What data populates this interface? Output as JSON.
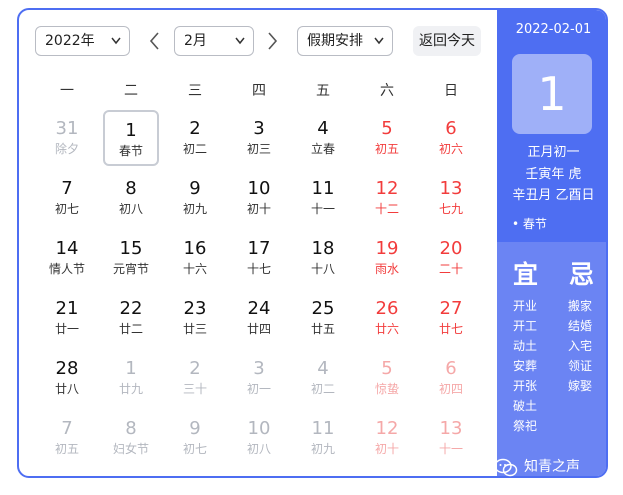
{
  "toolbar": {
    "year": "2022年",
    "month": "2月",
    "holiday": "假期安排",
    "today": "返回今天"
  },
  "weekdays": [
    "一",
    "二",
    "三",
    "四",
    "五",
    "六",
    "日"
  ],
  "days": [
    {
      "n": "31",
      "s": "除夕",
      "other": true
    },
    {
      "n": "1",
      "s": "春节",
      "sel": true
    },
    {
      "n": "2",
      "s": "初二"
    },
    {
      "n": "3",
      "s": "初三"
    },
    {
      "n": "4",
      "s": "立春"
    },
    {
      "n": "5",
      "s": "初五"
    },
    {
      "n": "6",
      "s": "初六"
    },
    {
      "n": "7",
      "s": "初七"
    },
    {
      "n": "8",
      "s": "初八"
    },
    {
      "n": "9",
      "s": "初九"
    },
    {
      "n": "10",
      "s": "初十"
    },
    {
      "n": "11",
      "s": "十一"
    },
    {
      "n": "12",
      "s": "十二"
    },
    {
      "n": "13",
      "s": "七九"
    },
    {
      "n": "14",
      "s": "情人节"
    },
    {
      "n": "15",
      "s": "元宵节"
    },
    {
      "n": "16",
      "s": "十六"
    },
    {
      "n": "17",
      "s": "十七"
    },
    {
      "n": "18",
      "s": "十八"
    },
    {
      "n": "19",
      "s": "雨水"
    },
    {
      "n": "20",
      "s": "二十"
    },
    {
      "n": "21",
      "s": "廿一"
    },
    {
      "n": "22",
      "s": "廿二"
    },
    {
      "n": "23",
      "s": "廿三"
    },
    {
      "n": "24",
      "s": "廿四"
    },
    {
      "n": "25",
      "s": "廿五"
    },
    {
      "n": "26",
      "s": "廿六"
    },
    {
      "n": "27",
      "s": "廿七"
    },
    {
      "n": "28",
      "s": "廿八"
    },
    {
      "n": "1",
      "s": "廿九",
      "other": true
    },
    {
      "n": "2",
      "s": "三十",
      "other": true
    },
    {
      "n": "3",
      "s": "初一",
      "other": true
    },
    {
      "n": "4",
      "s": "初二",
      "other": true
    },
    {
      "n": "5",
      "s": "惊蛰",
      "other": true
    },
    {
      "n": "6",
      "s": "初四",
      "other": true
    },
    {
      "n": "7",
      "s": "初五",
      "other": true
    },
    {
      "n": "8",
      "s": "妇女节",
      "other": true
    },
    {
      "n": "9",
      "s": "初七",
      "other": true
    },
    {
      "n": "10",
      "s": "初八",
      "other": true
    },
    {
      "n": "11",
      "s": "初九",
      "other": true
    },
    {
      "n": "12",
      "s": "初十",
      "other": true
    },
    {
      "n": "13",
      "s": "十一",
      "other": true
    }
  ],
  "detail": {
    "date": "2022-02-01",
    "day": "1",
    "lunar_date": "正月初一",
    "lunar_year": "壬寅年 虎",
    "ganzhi": "辛丑月 乙酉日",
    "festival": "• 春节",
    "yi_title": "宜",
    "ji_title": "忌",
    "yi": [
      "开业",
      "开工",
      "动土",
      "安葬",
      "开张",
      "破土",
      "祭祀"
    ],
    "ji": [
      "搬家",
      "结婚",
      "入宅",
      "领证",
      "嫁娶"
    ]
  },
  "watermark": "知青之声",
  "colors": {
    "accent": "#4e6ef2",
    "weekend": "#f23c3c"
  }
}
